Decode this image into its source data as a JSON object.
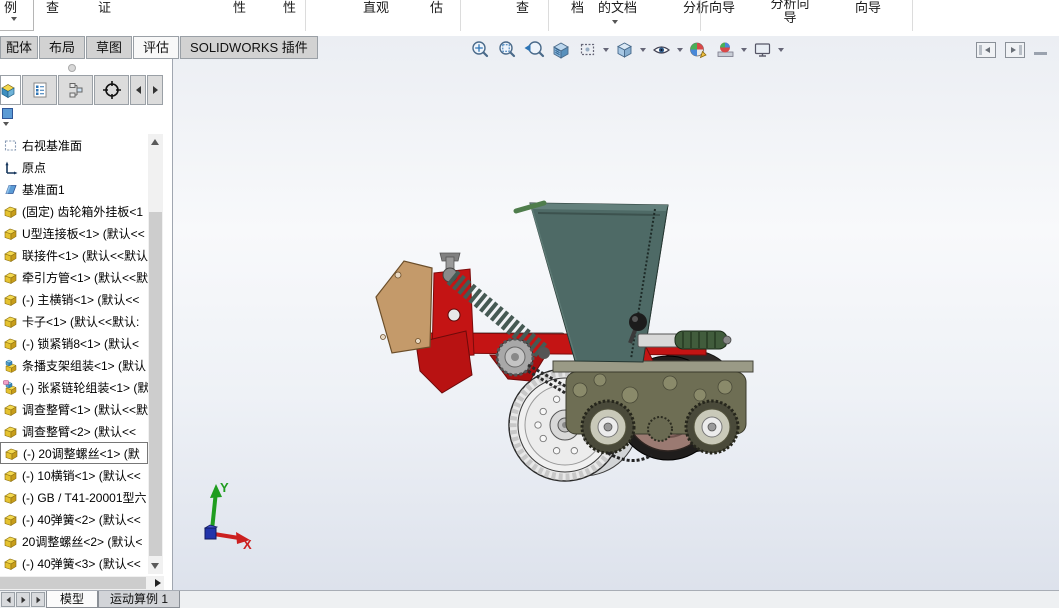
{
  "ribbon": {
    "labels": [
      "例",
      "查",
      "证",
      "性",
      "性",
      "直观",
      "估",
      "查",
      "档",
      "的文档",
      "分析向导",
      "分析向导",
      "向导"
    ]
  },
  "command_tabs": {
    "active": "评估",
    "items": [
      {
        "label": "配体"
      },
      {
        "label": "布局"
      },
      {
        "label": "草图"
      },
      {
        "label": "评估"
      },
      {
        "label": "SOLIDWORKS 插件"
      }
    ]
  },
  "headsup_toolbar": {
    "icons": [
      "zoom-to-fit",
      "zoom-to-area",
      "previous-view",
      "section-view",
      "annotation-views",
      "view-orientation",
      "hide-show-items",
      "edit-appearance",
      "apply-scene",
      "view-settings"
    ]
  },
  "pane_controls": {
    "icons": [
      "collapse-left-pane",
      "collapse-right-pane",
      "minimize-bar"
    ]
  },
  "feature_panel": {
    "tabs": [
      "features",
      "properties",
      "configurations",
      "dimxpert"
    ],
    "tree": {
      "items": [
        {
          "icon": "plane",
          "label": "右视基准面"
        },
        {
          "icon": "origin",
          "label": "原点"
        },
        {
          "icon": "planes",
          "label": "基准面1"
        },
        {
          "icon": "part",
          "label": "(固定) 齿轮箱外挂板<1"
        },
        {
          "icon": "part",
          "label": "U型连接板<1> (默认<<"
        },
        {
          "icon": "part",
          "label": "联接件<1> (默认<<默认"
        },
        {
          "icon": "part",
          "label": "牵引方管<1> (默认<<默"
        },
        {
          "icon": "part",
          "label": "(-) 主横销<1> (默认<<"
        },
        {
          "icon": "part",
          "label": "卡子<1> (默认<<默认:"
        },
        {
          "icon": "part",
          "label": "(-) 锁紧销8<1> (默认<"
        },
        {
          "icon": "asm",
          "label": "条播支架组装<1> (默认"
        },
        {
          "icon": "asmflex",
          "label": "(-) 张紧链轮组装<1> (默"
        },
        {
          "icon": "part",
          "label": "调查整臂<1> (默认<<默"
        },
        {
          "icon": "part",
          "label": "调查整臂<2> (默认<<"
        },
        {
          "icon": "part",
          "label": "(-) 20调整螺丝<1> (默",
          "selected": true
        },
        {
          "icon": "part",
          "label": "(-) 10横销<1> (默认<<"
        },
        {
          "icon": "part",
          "label": "(-) GB / T41-20001型六"
        },
        {
          "icon": "part",
          "label": "(-) 40弹簧<2> (默认<<"
        },
        {
          "icon": "part",
          "label": "20调整螺丝<2> (默认<"
        },
        {
          "icon": "part",
          "label": "(-) 40弹簧<3> (默认<<"
        }
      ]
    }
  },
  "viewport": {
    "triad": {
      "x_label": "X",
      "y_label": "Y"
    }
  },
  "bottom_bar": {
    "active": "模型",
    "tabs": [
      {
        "label": "模型"
      },
      {
        "label": "运动算例 1"
      }
    ]
  },
  "colors": {
    "frame_red": "#c41414",
    "hopper_green": "#4e6a66",
    "bracket_tan": "#c49a6a",
    "part_icon_yellow": "#f3d84e",
    "axis_x_red": "#cc2020",
    "axis_y_green": "#1f9d1f",
    "axis_z_blue": "#2233aa"
  }
}
